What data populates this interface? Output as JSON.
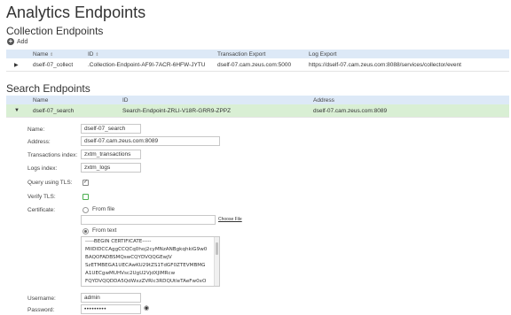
{
  "page": {
    "title": "Analytics Endpoints"
  },
  "collection": {
    "title": "Collection Endpoints",
    "add_label": "Add",
    "columns": [
      "Name",
      "ID",
      "Transaction Export",
      "Log Export"
    ],
    "rows": [
      {
        "name": "dself-07_collect",
        "id": ".Collection-Endpoint-AF9I-7ACR-6HFW-JYTU",
        "tx": "dself-07.cam.zeus.com:5000",
        "log": "https://dself-07.cam.zeus.com:8088/services/collector/event"
      }
    ]
  },
  "search": {
    "title": "Search Endpoints",
    "columns": [
      "Name",
      "ID",
      "Address"
    ],
    "rows": [
      {
        "name": "dself-07_search",
        "id": "Search-Endpoint-ZRLI-V18R-GRR9-ZPPZ",
        "address": "dself-07.cam.zeus.com:8089"
      }
    ]
  },
  "form": {
    "name_label": "Name:",
    "name_value": "dself-07_search",
    "address_label": "Address:",
    "address_value": "dself-07.cam.zeus.com:8089",
    "tx_index_label": "Transactions index:",
    "tx_index_value": "zxtm_transactions",
    "logs_index_label": "Logs index:",
    "logs_index_value": "zxtm_logs",
    "tls_label": "Query using TLS:",
    "tls_checked": true,
    "verify_label": "Verify TLS:",
    "verify_checked": false,
    "cert_label": "Certificate:",
    "from_file_label": "From file",
    "choose_file_label": "Choose File",
    "from_text_label": "From text",
    "cert_lines": [
      "-----BEGIN CERTIFICATE-----",
      "MIIDIDCCAggCCQCq0hoj2cyMNzANBgkqhkiG9w0",
      "BAQOFADBSMQswCQYDVQQGEwJV",
      "SzETMBEGA1UECAwKU29tZS1TdGF0ZTEVMBMG",
      "A1UECgwMUHVsc2UgU2VjdXJlMRcw",
      "FQYDVQQDDA5QdWxzZVRlc3RDQUtleTAeFw0xO"
    ],
    "username_label": "Username:",
    "username_value": "admin",
    "password_label": "Password:",
    "password_value": "•••••••••"
  },
  "colors": {
    "header_bg": "#dde9f7",
    "selected_row_bg": "#d9efd4",
    "check_green": "#4caf50"
  }
}
